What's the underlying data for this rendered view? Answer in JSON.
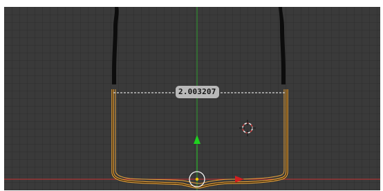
{
  "viewport": {
    "measure_value": "2.003207",
    "colors": {
      "background": "#3a3a3a",
      "grid_line": "#333333",
      "y_axis": "#2e9c2e",
      "x_axis": "#c83232",
      "selection_outline": "#e8a33a",
      "mesh_fill": "#0c0c0c",
      "measure_line": "#d8d8d8",
      "measure_label_bg": "#b9b9b9",
      "cursor_ring_red": "#d23c3c",
      "cursor_ring_white": "#f2f2f2",
      "pivot_dot": "#f0c800"
    },
    "icons": {
      "cursor": "3d-cursor-icon",
      "manipulator": "transform-manipulator-icon",
      "arrow": "arrow-head-icon"
    }
  }
}
